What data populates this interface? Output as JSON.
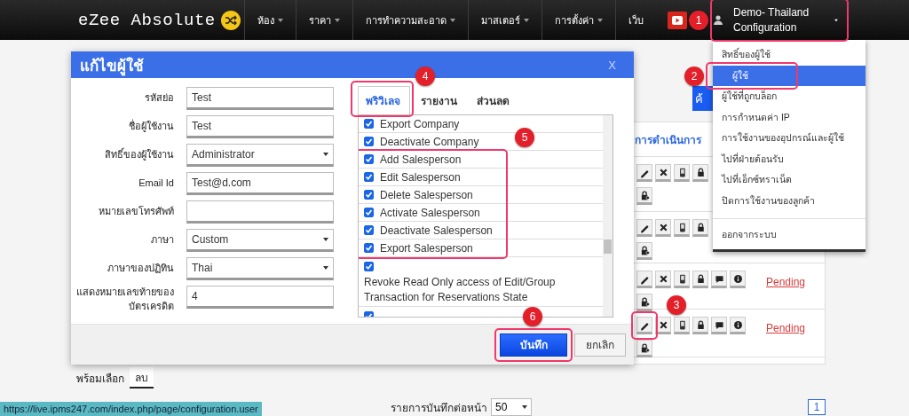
{
  "nav": {
    "logo": "eZee Absolute",
    "menu": [
      {
        "label": "ห้อง",
        "has_caret": true
      },
      {
        "label": "ราคา",
        "has_caret": true
      },
      {
        "label": "การทำความสะอาด",
        "has_caret": true
      },
      {
        "label": "มาสเตอร์",
        "has_caret": true
      },
      {
        "label": "การตั้งค่า",
        "has_caret": true
      },
      {
        "label": "เว็บ",
        "has_caret": false
      }
    ],
    "user": {
      "label": "Demo- Thailand Configuration",
      "callout": "1"
    }
  },
  "user_menu": {
    "items": [
      {
        "label": "สิทธิ์ของผู้ใช้",
        "selected": false
      },
      {
        "label": "ผู้ใช้",
        "selected": true,
        "callout": "2"
      },
      {
        "label": "ผู้ใช้ที่ถูกบล็อก",
        "selected": false
      },
      {
        "label": "การกำหนดค่า IP",
        "selected": false
      },
      {
        "label": "การใช้งานของอุปกรณ์และผู้ใช้",
        "selected": false
      },
      {
        "label": "ไปที่ฝ่ายต้อนรับ",
        "selected": false
      },
      {
        "label": "ไปที่เอ็กซ์ทราเน็ต",
        "selected": false
      },
      {
        "label": "ปิดการใช้งานของลูกค้า",
        "selected": false
      }
    ],
    "logout": "ออกจากระบบ"
  },
  "page": {
    "search_button": "ค้",
    "actions_header": "การดำเนินการ",
    "rows": [
      {
        "kind": "covered"
      },
      {
        "kind": "covered"
      },
      {
        "kind": "full",
        "status": "Pending"
      },
      {
        "kind": "full",
        "status": "Pending",
        "edit_callout": "3"
      }
    ],
    "bottom_tabs": [
      {
        "label": "พร้อมเลือก",
        "selected": false
      },
      {
        "label": "ลบ",
        "selected": true
      }
    ],
    "per_page_label": "รายการบันทึกต่อหน้า",
    "per_page": "50",
    "pages": [
      {
        "label": "1",
        "selected": true
      }
    ],
    "status_url": "https://live.ipms247.com/index.php/page/configuration.user"
  },
  "modal": {
    "title": "แก้ไขผู้ใช้",
    "close": "X",
    "fields": [
      {
        "label": "รหัสย่อ",
        "kind": "text",
        "value": "Test"
      },
      {
        "label": "ชื่อผู้ใช้งาน",
        "kind": "text",
        "value": "Test"
      },
      {
        "label": "สิทธิ์ของผู้ใช้งาน",
        "kind": "select",
        "value": "Administrator"
      },
      {
        "label": "Email Id",
        "kind": "text",
        "value": "Test@d.com"
      },
      {
        "label": "หมายเลขโทรศัพท์",
        "kind": "text"
      },
      {
        "label": "ภาษา",
        "kind": "select",
        "value": "Custom"
      },
      {
        "label": "ภาษาของปฏิทิน",
        "kind": "select",
        "value": "Thai"
      },
      {
        "label": "แสดงหมายเลขท้ายของบัตรเครดิต",
        "kind": "text",
        "value": "4"
      }
    ],
    "tabs": [
      {
        "label": "พริวิเลจ",
        "selected": true,
        "callout": "4"
      },
      {
        "label": "รายงาน",
        "selected": false
      },
      {
        "label": "ส่วนลด",
        "selected": false
      }
    ],
    "privileges": [
      {
        "label": "Export Company",
        "checked": true,
        "kind": "line"
      },
      {
        "label": "Deactivate Company",
        "checked": true,
        "kind": "line"
      },
      {
        "label": "Add Salesperson",
        "checked": true,
        "kind": "line",
        "group": true
      },
      {
        "label": "Edit Salesperson",
        "checked": true,
        "kind": "line",
        "group": true
      },
      {
        "label": "Delete Salesperson",
        "checked": true,
        "kind": "line",
        "group": true
      },
      {
        "label": "Activate Salesperson",
        "checked": true,
        "kind": "line",
        "group": true
      },
      {
        "label": "Deactivate Salesperson",
        "checked": true,
        "kind": "line",
        "group": true
      },
      {
        "label": "Export Salesperson",
        "checked": true,
        "kind": "line",
        "group": true
      },
      {
        "label": "Revoke Read Only access of Edit/Group Transaction for Reservations State",
        "checked": true,
        "kind": "block"
      },
      {
        "checked": true,
        "kind": "block"
      }
    ],
    "group_callout": "5",
    "save": {
      "label": "บันทึก",
      "callout": "6"
    },
    "cancel": "ยกเลิก"
  }
}
